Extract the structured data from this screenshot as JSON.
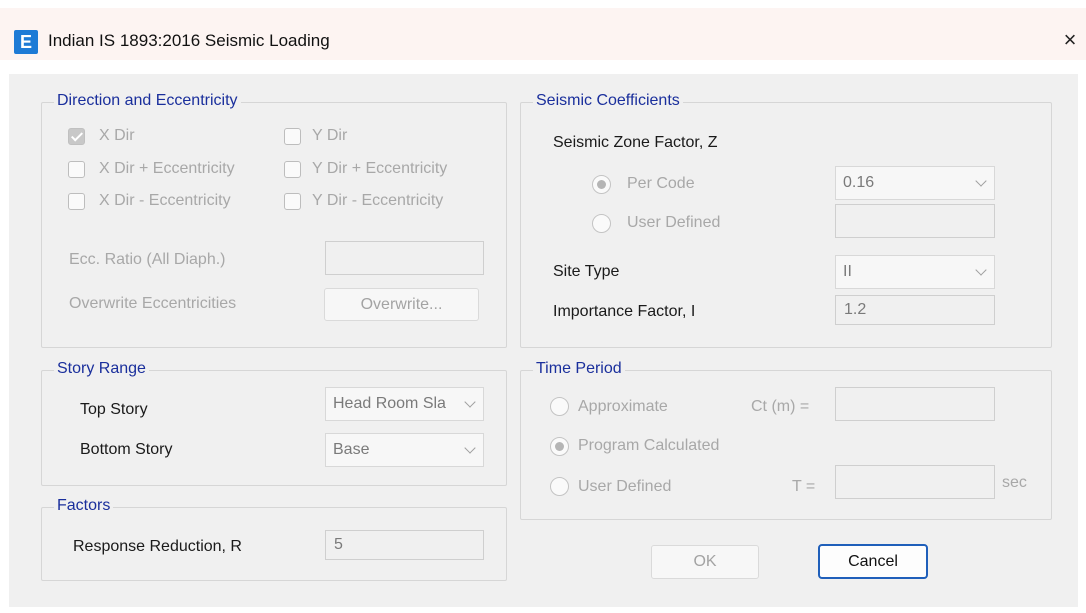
{
  "window": {
    "app_icon_glyph": "E",
    "title": "Indian IS 1893:2016 Seismic Loading",
    "close_glyph": "×"
  },
  "direction": {
    "legend": "Direction and Eccentricity",
    "checkboxes": [
      {
        "label": "X Dir",
        "checked": true
      },
      {
        "label": "Y Dir",
        "checked": false
      },
      {
        "label": "X Dir + Eccentricity",
        "checked": false
      },
      {
        "label": "Y Dir + Eccentricity",
        "checked": false
      },
      {
        "label": "X Dir - Eccentricity",
        "checked": false
      },
      {
        "label": "Y Dir - Eccentricity",
        "checked": false
      }
    ],
    "ecc_ratio_label": "Ecc. Ratio (All Diaph.)",
    "ecc_ratio_value": "",
    "overwrite_label": "Overwrite Eccentricities",
    "overwrite_button": "Overwrite..."
  },
  "story_range": {
    "legend": "Story Range",
    "top_story_label": "Top Story",
    "top_story_value": "Head Room Sla",
    "bottom_story_label": "Bottom Story",
    "bottom_story_value": "Base"
  },
  "factors": {
    "legend": "Factors",
    "response_reduction_label": "Response Reduction, R",
    "response_reduction_value": "5"
  },
  "seismic": {
    "legend": "Seismic Coefficients",
    "zone_factor_label": "Seismic Zone Factor, Z",
    "per_code_label": "Per Code",
    "per_code_selected": true,
    "per_code_value": "0.16",
    "user_defined_label": "User Defined",
    "user_defined_value": "",
    "site_type_label": "Site Type",
    "site_type_value": "II",
    "importance_label": "Importance Factor, I",
    "importance_value": "1.2"
  },
  "time_period": {
    "legend": "Time Period",
    "approximate_label": "Approximate",
    "ct_label": "Ct (m) =",
    "ct_value": "",
    "program_calculated_label": "Program Calculated",
    "program_calculated_selected": true,
    "user_defined_label": "User Defined",
    "t_label": "T =",
    "t_value": "",
    "sec_label": "sec"
  },
  "buttons": {
    "ok": "OK",
    "cancel": "Cancel"
  },
  "icons": [
    "app-icon",
    "close-icon",
    "chevron-down-icon"
  ]
}
